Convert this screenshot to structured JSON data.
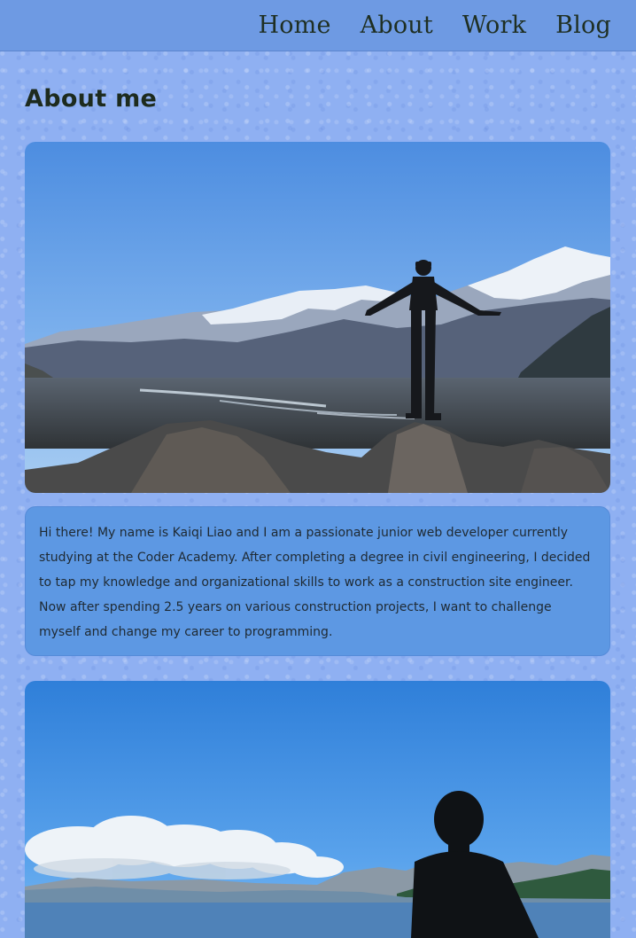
{
  "nav": {
    "items": [
      {
        "label": "Home"
      },
      {
        "label": "About"
      },
      {
        "label": "Work"
      },
      {
        "label": "Blog"
      }
    ]
  },
  "page": {
    "title": "About me"
  },
  "bio": {
    "text": "Hi there! My name is Kaiqi Liao and I am a passionate junior web developer currently studying at the Coder Academy. After completing a degree in civil engineering, I decided to tap my knowledge and organizational skills to work as a construction site engineer. Now after spending 2.5 years on various construction projects, I want to challenge myself and change my career to programming."
  },
  "colors": {
    "background": "#8fb0f2",
    "navbar": "#6e9ae3",
    "card": "#5d98e3",
    "text": "#1f2a33"
  }
}
